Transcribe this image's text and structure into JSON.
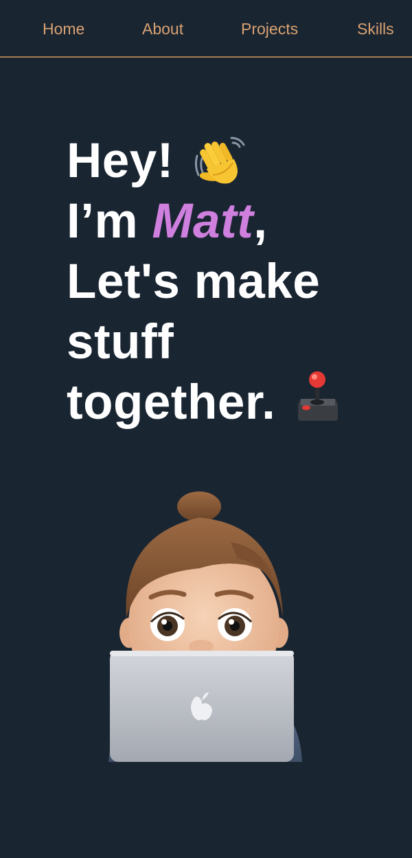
{
  "nav": {
    "items": [
      {
        "label": "Home"
      },
      {
        "label": "About"
      },
      {
        "label": "Projects"
      },
      {
        "label": "Skills"
      }
    ],
    "link_color": "#d9a271",
    "border_color": "#a67c52"
  },
  "hero": {
    "line1": "Hey!",
    "line2_prefix": "I’m ",
    "name": "Matt",
    "line2_suffix": ",",
    "line3": "Let's make",
    "line4": "stuff",
    "line5": "together.",
    "wave_icon": "waving-hand-icon",
    "joystick_icon": "joystick-icon",
    "text_color": "#ffffff",
    "name_color": "#cf7fdd"
  },
  "avatar": {
    "icon": "memoji-laptop-avatar"
  },
  "page": {
    "background": "#1a2532"
  }
}
